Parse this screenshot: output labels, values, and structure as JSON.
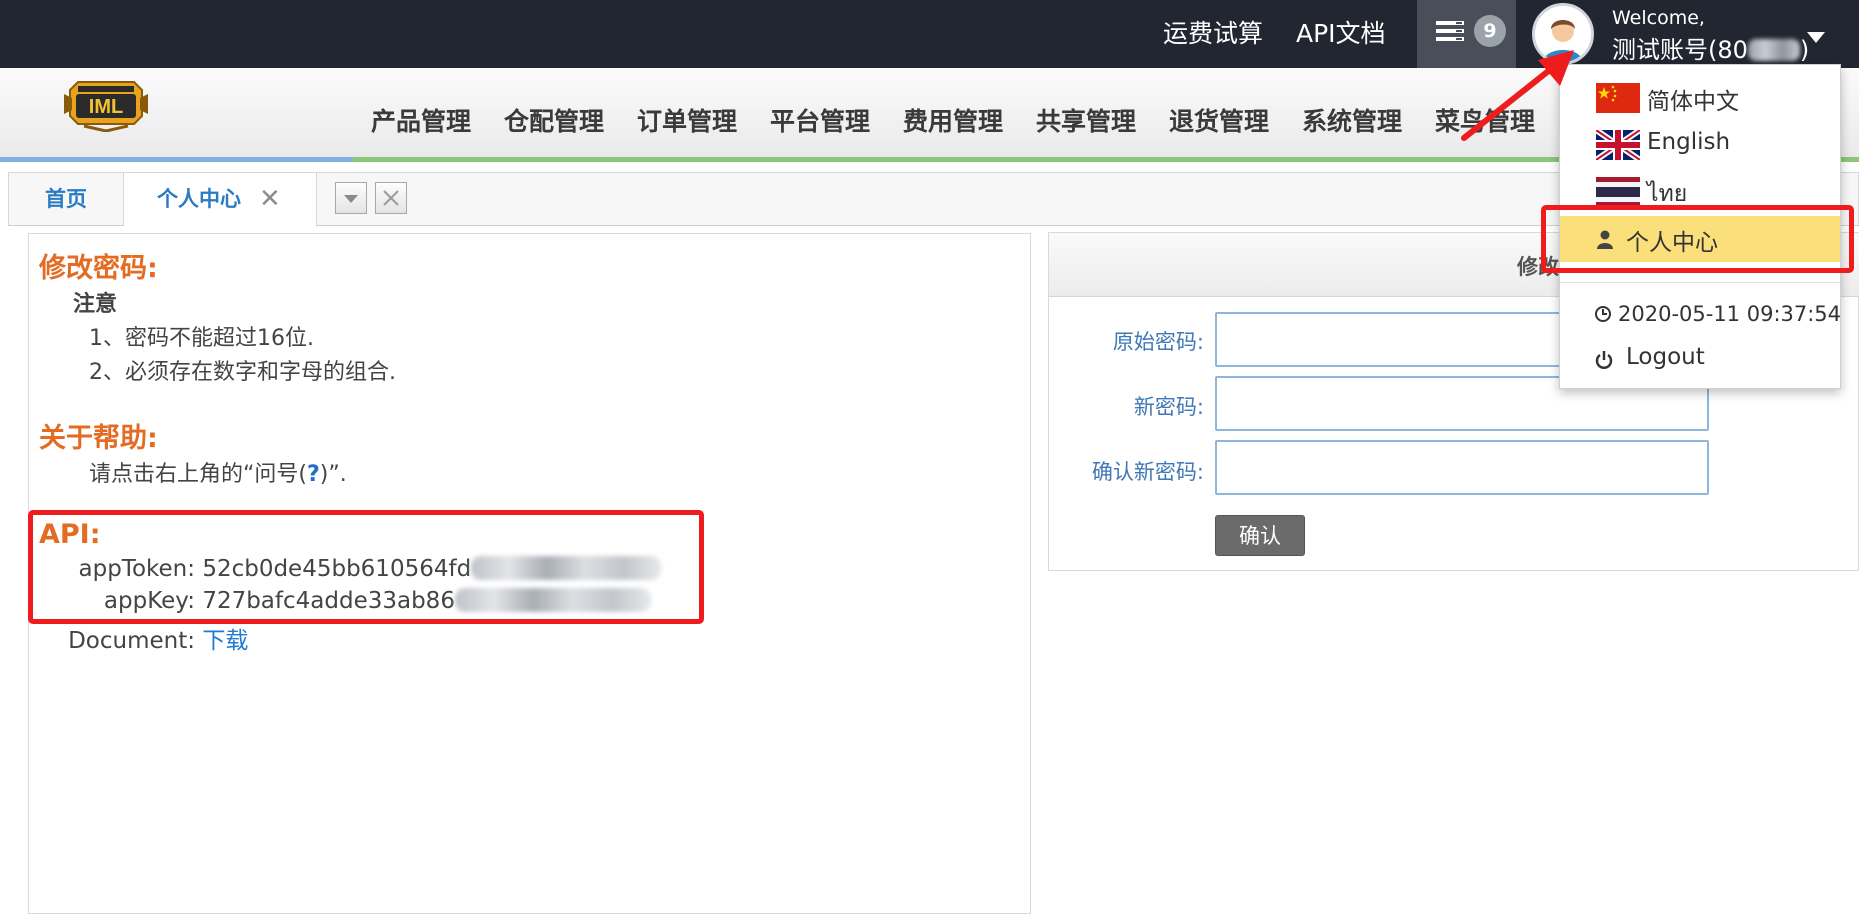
{
  "topbar": {
    "freight_calc": "运费试算",
    "api_docs": "API文档",
    "message_count": "9",
    "welcome": "Welcome,",
    "username_prefix": "测试账号(80",
    "username_suffix": ")"
  },
  "nav": {
    "items": [
      "产品管理",
      "仓配管理",
      "订单管理",
      "平台管理",
      "费用管理",
      "共享管理",
      "退货管理",
      "系统管理",
      "菜鸟管理"
    ]
  },
  "tabs": {
    "home": "首页",
    "personal_center": "个人中心",
    "close_glyph": "✕"
  },
  "left": {
    "change_pwd_title": "修改密码:",
    "note_title": "注意",
    "note_1": "1、密码不能超过16位.",
    "note_2": "2、必须存在数字和字母的组合.",
    "help_title": "关于帮助:",
    "help_text_before": "请点击右上角的“问号(",
    "help_qmark": "?",
    "help_text_after": ")”.",
    "api_title": "API:",
    "app_token_label": "appToken:",
    "app_token_value": "52cb0de45bb610564fd",
    "app_key_label": "appKey:",
    "app_key_value": "727bafc4adde33ab86",
    "document_label": "Document:",
    "document_link": "下载"
  },
  "right": {
    "title": "修改",
    "original_pwd_label": "原始密码:",
    "new_pwd_label": "新密码:",
    "confirm_pwd_label": "确认新密码:",
    "confirm_button": "确认"
  },
  "dropdown": {
    "lang_zh": "简体中文",
    "lang_en": "English",
    "lang_th": "ไทย",
    "personal_center": "个人中心",
    "datetime": "2020-05-11 09:37:54",
    "logout": "Logout"
  },
  "colors": {
    "topbar_bg": "#222631",
    "section_title": "#e36c22",
    "highlight_box": "#ee1c1c",
    "menu_highlight": "#fbdf7b",
    "link": "#1f7ad1"
  }
}
